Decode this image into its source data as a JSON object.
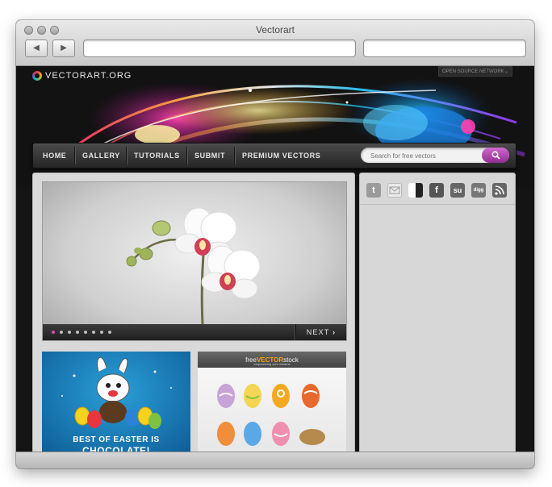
{
  "window": {
    "title": "Vectorart"
  },
  "site": {
    "logo_text": "VECTORART.ORG",
    "network_dropdown": "OPEN SOURCE NETWORK",
    "nav": [
      "HOME",
      "GALLERY",
      "TUTORIALS",
      "SUBMIT",
      "PREMIUM VECTORS"
    ],
    "search_placeholder": "Search for free vectors",
    "slider": {
      "next_label": "NEXT",
      "dot_count": 8,
      "active_dot": 0
    },
    "thumb1": {
      "line1": "BEST OF EASTER IS",
      "line2": "CHOCOLATE!"
    },
    "thumb2": {
      "brand_a": "free",
      "brand_b": "VECTOR",
      "brand_c": "stock",
      "tagline": "empowering your dreams"
    },
    "social_icons": [
      "twitter-icon",
      "email-icon",
      "delicious-icon",
      "facebook-icon",
      "stumbleupon-icon",
      "digg-icon",
      "rss-icon"
    ],
    "social_glyphs": {
      "twitter": "t",
      "facebook": "f",
      "stumble": "su",
      "digg": "digg"
    }
  },
  "colors": {
    "accent_pink": "#e24aa8",
    "search_button": "#a43fa8"
  }
}
